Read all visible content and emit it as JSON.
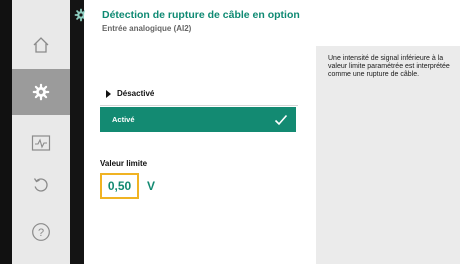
{
  "nav": {
    "items": [
      {
        "icon": "home-icon",
        "active": false
      },
      {
        "icon": "settings-gear-icon",
        "active": true
      },
      {
        "icon": "diagnostics-monitor-icon",
        "active": false
      },
      {
        "icon": "restore-undo-icon",
        "active": false
      },
      {
        "icon": "help-icon",
        "active": false
      }
    ]
  },
  "header": {
    "title": "Détection de rupture de câble en option",
    "subtitle": "Entrée analogique (AI2)"
  },
  "options": {
    "off_label": "Désactivé",
    "on_label": "Activé",
    "selected": "Activé"
  },
  "limit": {
    "label": "Valeur limite",
    "value": "0,50",
    "unit": "V"
  },
  "info": {
    "text": "Une intensité de signal inférieure à la valeur limite paramétrée est interprétée comme une rupture de câble."
  },
  "colors": {
    "accent": "#138a72",
    "highlight": "#f0b323",
    "sidebar_active": "#9b9b9b"
  }
}
